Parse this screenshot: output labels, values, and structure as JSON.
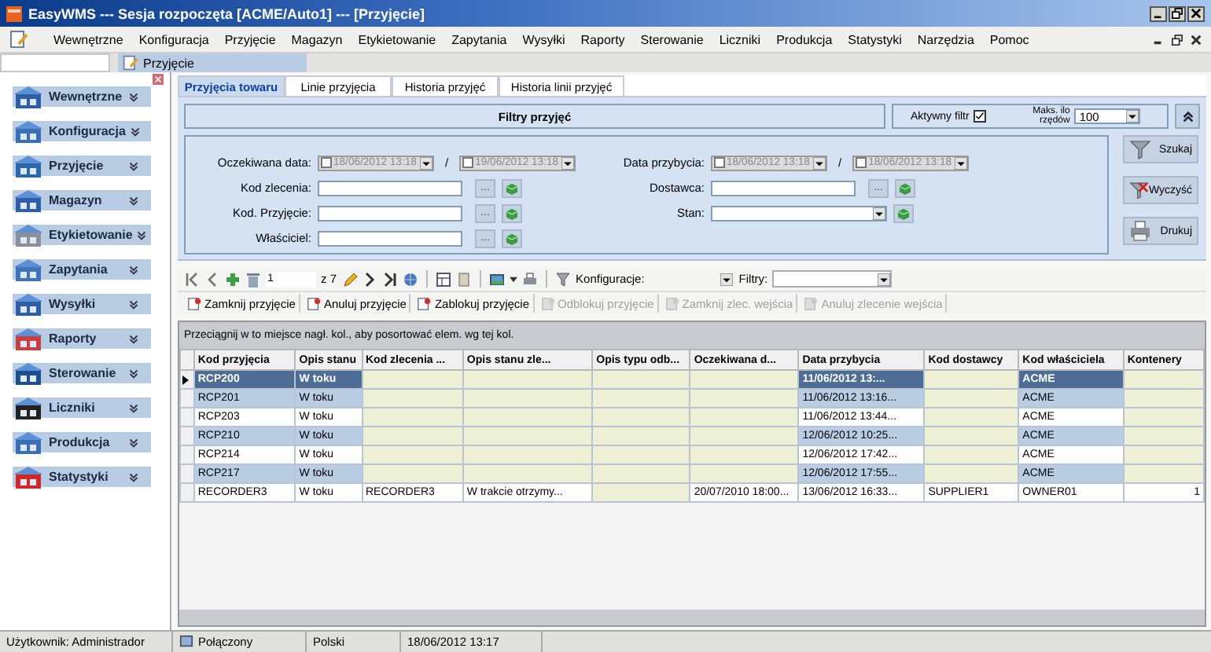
{
  "window": {
    "title": "EasyWMS --- Sesja rozpoczęta [ACME/Auto1] --- [Przyjęcie]"
  },
  "menu": [
    "Wewnętrzne",
    "Konfiguracja",
    "Przyjęcie",
    "Magazyn",
    "Etykietowanie",
    "Zapytania",
    "Wysyłki",
    "Raporty",
    "Sterowanie",
    "Liczniki",
    "Produkcja",
    "Statystyki",
    "Narzędzia",
    "Pomoc"
  ],
  "document_tab": {
    "label": "Przyjęcie"
  },
  "sidebar": {
    "items": [
      {
        "label": "Wewnętrzne"
      },
      {
        "label": "Konfiguracja"
      },
      {
        "label": "Przyjęcie"
      },
      {
        "label": "Magazyn"
      },
      {
        "label": "Etykietowanie"
      },
      {
        "label": "Zapytania"
      },
      {
        "label": "Wysyłki"
      },
      {
        "label": "Raporty"
      },
      {
        "label": "Sterowanie"
      },
      {
        "label": "Liczniki"
      },
      {
        "label": "Produkcja"
      },
      {
        "label": "Statystyki"
      }
    ]
  },
  "tabs": [
    {
      "label": "Przyjęcia towaru",
      "selected": true
    },
    {
      "label": "Linie przyjęcia",
      "selected": false
    },
    {
      "label": "Historia przyjęć",
      "selected": false
    },
    {
      "label": "Historia linii przyjęć",
      "selected": false
    }
  ],
  "filters": {
    "title": "Filtry przyjęć",
    "active_filter": {
      "label": "Aktywny filtr",
      "checked": true
    },
    "max_rows": {
      "label": "Maks. ilo rzędów",
      "value": "100"
    },
    "left": [
      {
        "kind": "date_range",
        "label": "Oczekiwana data:",
        "from": "18/06/2012 13:18",
        "from_checked": false,
        "separator": "/",
        "to": "19/06/2012 13:18",
        "to_checked": false
      },
      {
        "kind": "lookup",
        "label": "Kod zlecenia:",
        "browse": "..."
      },
      {
        "kind": "lookup",
        "label": "Kod. Przyjęcie:",
        "browse": "..."
      },
      {
        "kind": "lookup",
        "label": "Właściciel:",
        "browse": "..."
      }
    ],
    "right": [
      {
        "kind": "date_range",
        "label": "Data przybycia:",
        "from": "18/06/2012 13:18",
        "from_checked": false,
        "separator": "/",
        "to": "18/06/2012 13:18",
        "to_checked": false
      },
      {
        "kind": "lookup",
        "label": "Dostawca:",
        "browse": "..."
      },
      {
        "kind": "select",
        "label": "Stan:"
      }
    ],
    "buttons": [
      {
        "label": "Szukaj",
        "kind": "search"
      },
      {
        "label": "Wyczyść",
        "kind": "clear"
      },
      {
        "label": "Drukuj",
        "kind": "print"
      }
    ]
  },
  "toolbar": {
    "page": "1",
    "page_count": "z 7",
    "configurations_label": "Konfiguracje:",
    "filters_label": "Filtry:"
  },
  "actions": [
    {
      "label": "Zamknij przyjęcie",
      "disabled": false
    },
    {
      "label": "Anuluj przyjęcie",
      "disabled": false
    },
    {
      "label": "Zablokuj przyjęcie",
      "disabled": false
    },
    {
      "label": "Odblokuj przyjęcie",
      "disabled": true
    },
    {
      "label": "Zamknij zlec. wejścia",
      "disabled": true
    },
    {
      "label": "Anuluj zlecenie wejścia",
      "disabled": true
    }
  ],
  "group_hint": "Przeciągnij w to miejsce nagł. kol., aby posortować elem. wg tej kol.",
  "table": {
    "columns": [
      "Kod przyjęcia",
      "Opis stanu",
      "Kod zlecenia ...",
      "Opis stanu zle...",
      "Opis typu odb...",
      "Oczekiwana d...",
      "Data przybycia",
      "Kod dostawcy",
      "Kod właściciela",
      "Kontenery"
    ],
    "rows": [
      {
        "selected": true,
        "cells": [
          "RCP200",
          "W toku",
          null,
          null,
          null,
          null,
          "11/06/2012 13:...",
          null,
          "ACME",
          null
        ]
      },
      {
        "selected": false,
        "cells": [
          "RCP201",
          "W toku",
          null,
          null,
          null,
          null,
          "11/06/2012 13:16...",
          null,
          "ACME",
          null
        ]
      },
      {
        "selected": false,
        "cells": [
          "RCP203",
          "W toku",
          null,
          null,
          null,
          null,
          "11/06/2012 13:44...",
          null,
          "ACME",
          null
        ]
      },
      {
        "selected": false,
        "cells": [
          "RCP210",
          "W toku",
          null,
          null,
          null,
          null,
          "12/06/2012 10:25...",
          null,
          "ACME",
          null
        ]
      },
      {
        "selected": false,
        "cells": [
          "RCP214",
          "W toku",
          null,
          null,
          null,
          null,
          "12/06/2012 17:42...",
          null,
          "ACME",
          null
        ]
      },
      {
        "selected": false,
        "cells": [
          "RCP217",
          "W toku",
          null,
          null,
          null,
          null,
          "12/06/2012 17:55...",
          null,
          "ACME",
          null
        ]
      },
      {
        "selected": false,
        "cells": [
          "RECORDER3",
          "W toku",
          "RECORDER3",
          "W trakcie otrzymy...",
          null,
          "20/07/2010 18:00...",
          "13/06/2012 16:33...",
          "SUPPLIER1",
          "OWNER01",
          "1"
        ]
      }
    ]
  },
  "status_bar": {
    "user": "Użytkownik: Administrador",
    "connection": "Połączony",
    "language": "Polski",
    "datetime": "18/06/2012 13:17"
  }
}
